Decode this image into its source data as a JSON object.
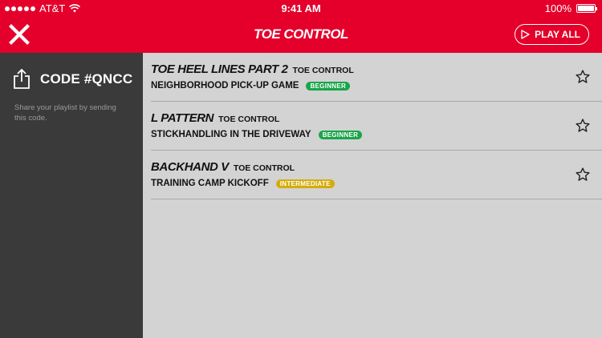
{
  "status": {
    "carrier": "AT&T",
    "time": "9:41 AM",
    "battery": "100%",
    "battery_level": 1.0
  },
  "header": {
    "title": "TOE CONTROL",
    "play_all_label": "PLAY ALL",
    "background_color": "#e4002b"
  },
  "sidebar": {
    "code": "CODE #QNCC",
    "description": "Share your playlist by sending this code."
  },
  "drills": [
    {
      "name": "TOE HEEL LINES PART 2",
      "category": "TOE CONTROL",
      "program": "NEIGHBORHOOD PICK-UP GAME",
      "level": "BEGINNER",
      "level_color": "#1aa54a"
    },
    {
      "name": "L PATTERN",
      "category": "TOE CONTROL",
      "program": "STICKHANDLING IN THE DRIVEWAY",
      "level": "BEGINNER",
      "level_color": "#1aa54a"
    },
    {
      "name": "BACKHAND V",
      "category": "TOE CONTROL",
      "program": "TRAINING CAMP KICKOFF",
      "level": "INTERMEDIATE",
      "level_color": "#d4ad0e"
    }
  ]
}
